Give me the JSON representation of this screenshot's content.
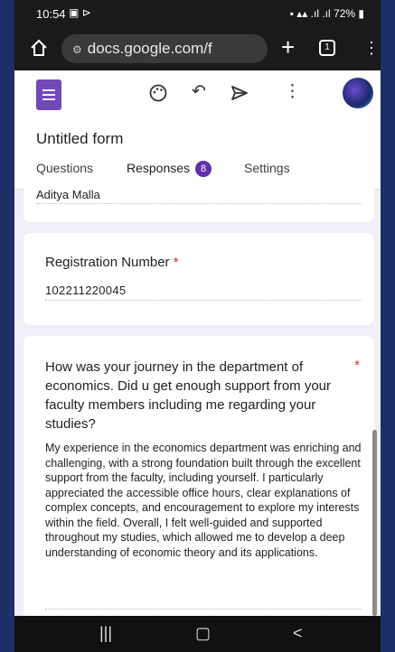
{
  "status_bar": {
    "time": "10:54",
    "battery": "72%"
  },
  "browser": {
    "url": "docs.google.com/f",
    "tab_count": "1"
  },
  "form": {
    "title": "Untitled form",
    "tabs": {
      "questions": "Questions",
      "responses": "Responses",
      "responses_count": "8",
      "settings": "Settings"
    }
  },
  "responses": [
    {
      "answer": "Aditya Malla"
    },
    {
      "question": "Registration Number",
      "required_marker": "*",
      "answer": "102211220045"
    },
    {
      "question": "How was your journey in the department of economics. Did u get enough support from your faculty members including me regarding your studies?",
      "required_marker": "*",
      "answer": "My experience in the economics department was enriching and challenging, with a strong foundation built through the excellent support from the faculty, including yourself. I particularly appreciated the accessible office hours, clear explanations of complex concepts, and encouragement to explore my interests within the field. Overall, I felt well-guided and supported throughout my studies, which allowed me to develop a deep understanding of economic theory and its applications."
    }
  ],
  "icons": [
    "image-icon",
    "cast-icon",
    "signal-icon",
    "battery-icon",
    "home-icon",
    "site-settings-icon",
    "plus-icon",
    "tabs-icon",
    "menu-icon",
    "forms-logo-icon",
    "palette-icon",
    "undo-icon",
    "send-icon",
    "more-icon",
    "recent-apps-icon",
    "home-nav-icon",
    "back-icon"
  ]
}
